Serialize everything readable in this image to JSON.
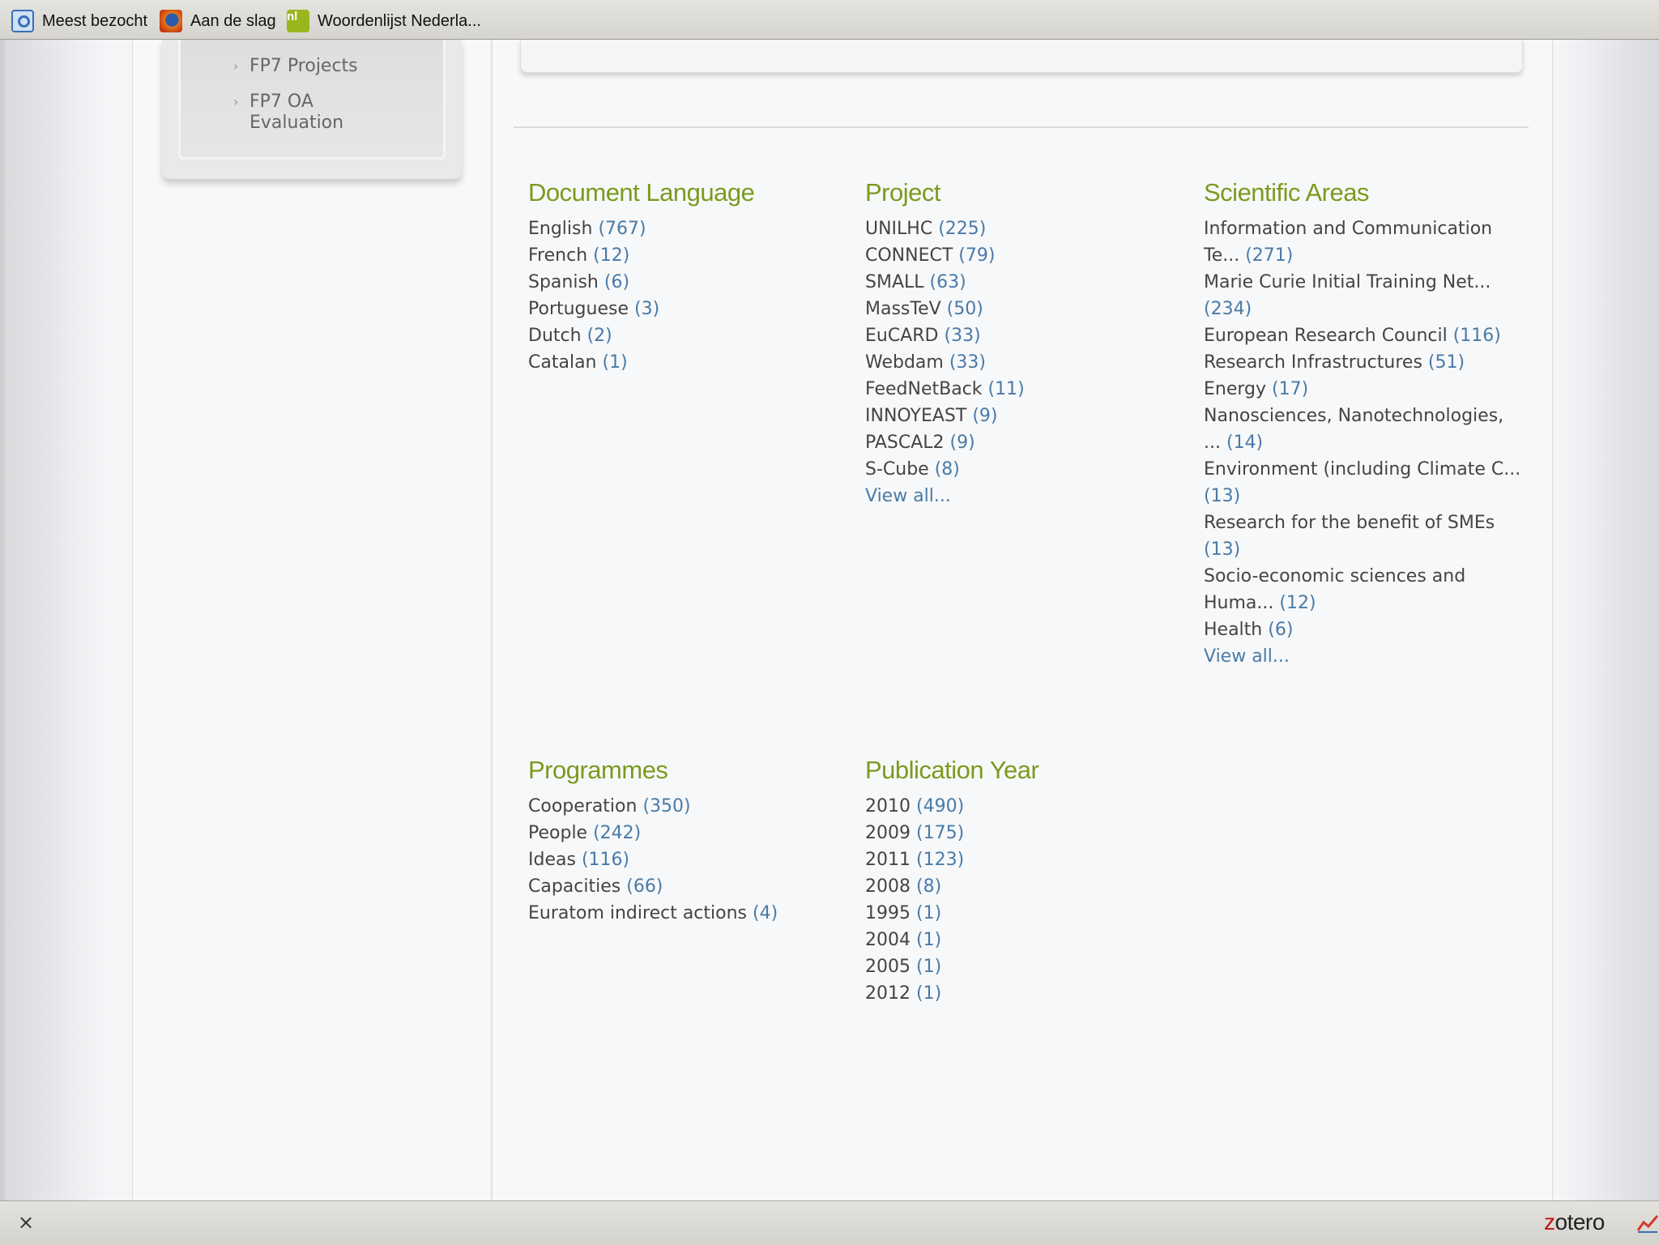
{
  "bookmarks": [
    {
      "label": "Meest bezocht",
      "icon": "search-icon"
    },
    {
      "label": "Aan de slag",
      "icon": "firefox-icon"
    },
    {
      "label": "Woordenlijst Nederla...",
      "icon": "woordenlijst-icon"
    }
  ],
  "sidebar": {
    "items": [
      {
        "label": "FP7 Projects"
      },
      {
        "label": "FP7 OA Evaluation"
      }
    ]
  },
  "facets": {
    "language": {
      "title": "Document Language",
      "items": [
        {
          "label": "English",
          "count": "(767)"
        },
        {
          "label": "French",
          "count": "(12)"
        },
        {
          "label": "Spanish",
          "count": "(6)"
        },
        {
          "label": "Portuguese",
          "count": "(3)"
        },
        {
          "label": "Dutch",
          "count": "(2)"
        },
        {
          "label": "Catalan",
          "count": "(1)"
        }
      ]
    },
    "project": {
      "title": "Project",
      "items": [
        {
          "label": "UNILHC",
          "count": "(225)"
        },
        {
          "label": "CONNECT",
          "count": "(79)"
        },
        {
          "label": "SMALL",
          "count": "(63)"
        },
        {
          "label": "MassTeV",
          "count": "(50)"
        },
        {
          "label": "EuCARD",
          "count": "(33)"
        },
        {
          "label": "Webdam",
          "count": "(33)"
        },
        {
          "label": "FeedNetBack",
          "count": "(11)"
        },
        {
          "label": "INNOYEAST",
          "count": "(9)"
        },
        {
          "label": "PASCAL2",
          "count": "(9)"
        },
        {
          "label": "S-Cube",
          "count": "(8)"
        }
      ],
      "view_all": "View all..."
    },
    "areas": {
      "title": "Scientific Areas",
      "items": [
        {
          "label": "Information and Communication Te...",
          "count": "(271)"
        },
        {
          "label": "Marie Curie Initial Training Net...",
          "count": "(234)"
        },
        {
          "label": "European Research Council",
          "count": "(116)"
        },
        {
          "label": "Research Infrastructures",
          "count": "(51)"
        },
        {
          "label": "Energy",
          "count": "(17)"
        },
        {
          "label": "Nanosciences, Nanotechnologies, ...",
          "count": "(14)"
        },
        {
          "label": "Environment (including Climate C...",
          "count": "(13)"
        },
        {
          "label": "Research for the benefit of SMEs",
          "count": "(13)"
        },
        {
          "label": "Socio-economic sciences and Huma...",
          "count": "(12)"
        },
        {
          "label": "Health",
          "count": "(6)"
        }
      ],
      "view_all": "View all..."
    },
    "programmes": {
      "title": "Programmes",
      "items": [
        {
          "label": "Cooperation",
          "count": "(350)"
        },
        {
          "label": "People",
          "count": "(242)"
        },
        {
          "label": "Ideas",
          "count": "(116)"
        },
        {
          "label": "Capacities",
          "count": "(66)"
        },
        {
          "label": "Euratom indirect actions",
          "count": "(4)"
        }
      ]
    },
    "year": {
      "title": "Publication Year",
      "items": [
        {
          "label": "2010",
          "count": "(490)"
        },
        {
          "label": "2009",
          "count": "(175)"
        },
        {
          "label": "2011",
          "count": "(123)"
        },
        {
          "label": "2008",
          "count": "(8)"
        },
        {
          "label": "1995",
          "count": "(1)"
        },
        {
          "label": "2004",
          "count": "(1)"
        },
        {
          "label": "2005",
          "count": "(1)"
        },
        {
          "label": "2012",
          "count": "(1)"
        }
      ]
    }
  },
  "statusbar": {
    "close": "×",
    "zotero_z": "z",
    "zotero_rest": "otero"
  },
  "colors": {
    "heading": "#7a9b1e",
    "count": "#4a7aa8",
    "text": "#444444"
  }
}
